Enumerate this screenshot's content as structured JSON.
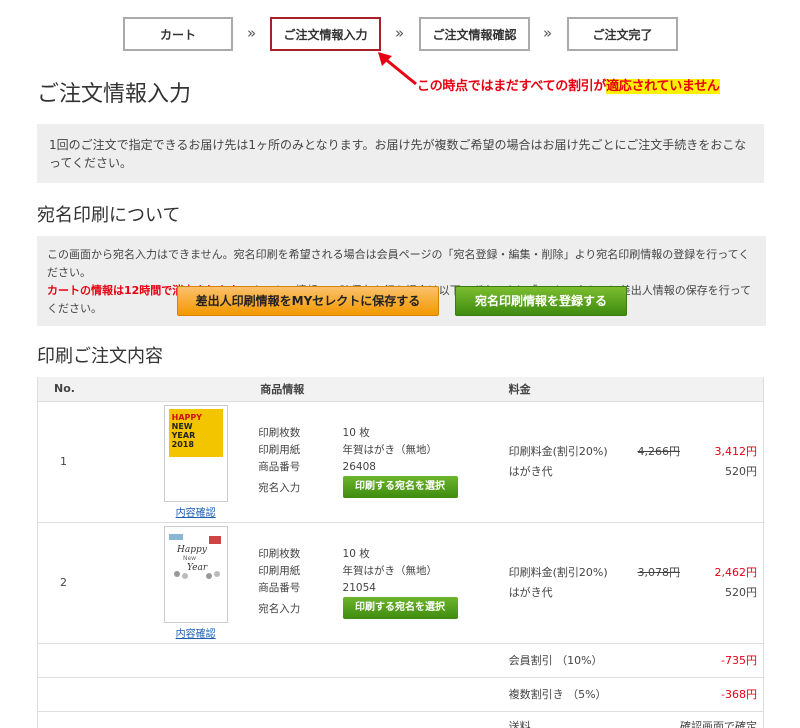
{
  "steps": [
    "カート",
    "ご注文情報入力",
    "ご注文情報確認",
    "ご注文完了"
  ],
  "step_separator": "»",
  "annotation": {
    "text_main": "この時点ではまだすべての割引が",
    "text_highlight": "適応されていません",
    "color": "#e60012"
  },
  "page_title": "ご注文情報入力",
  "notice": "1回のご注文で指定できるお届け先は1ヶ所のみとなります。お届け先が複数ご希望の場合はお届け先ごとにご注文手続きをおこなってください。",
  "atena": {
    "heading": "宛名印刷について",
    "line1": "この画面から宛名入力はできません。宛名印刷を希望される場合は会員ページの「宛名登録・編集・削除」より宛名印刷情報の登録を行ってください。",
    "line2_red": "カートの情報は12時間で消去されます。",
    "line2_rest": "カートの情報の一時保存を行う場合は以下のボタンより「MYセレクト」に差出人情報の保存を行ってください。",
    "save_button": "差出人印刷情報をMYセレクトに保存する",
    "register_button": "宛名印刷情報を登録する"
  },
  "order": {
    "heading": "印刷ご注文内容",
    "columns": [
      "No.",
      "商品情報",
      "料金"
    ],
    "items": [
      {
        "no": "1",
        "thumb_text": [
          "HAPPY",
          "NEW",
          "YEAR",
          "2018"
        ],
        "link": "内容確認",
        "specs": [
          {
            "label": "印刷枚数",
            "value": "10 枚"
          },
          {
            "label": "印刷用紙",
            "value": "年賀はがき（無地）"
          },
          {
            "label": "商品番号",
            "value": "26408"
          }
        ],
        "atena_label": "宛名入力",
        "select_button": "印刷する宛名を選択",
        "price_label": "印刷料金(割引20%)",
        "price_old": "4,266円",
        "price_new": "3,412円",
        "card_label": "はがき代",
        "card_price": "520円"
      },
      {
        "no": "2",
        "thumb_text": [
          "Happy",
          "New",
          "Year"
        ],
        "link": "内容確認",
        "specs": [
          {
            "label": "印刷枚数",
            "value": "10 枚"
          },
          {
            "label": "印刷用紙",
            "value": "年賀はがき（無地）"
          },
          {
            "label": "商品番号",
            "value": "21054"
          }
        ],
        "atena_label": "宛名入力",
        "select_button": "印刷する宛名を選択",
        "price_label": "印刷料金(割引20%)",
        "price_old": "3,078円",
        "price_new": "2,462円",
        "card_label": "はがき代",
        "card_price": "520円"
      }
    ],
    "discounts": [
      {
        "label": "会員割引 （10%）",
        "value": "-735円"
      },
      {
        "label": "複数割引き （5%）",
        "value": "-368円"
      }
    ],
    "partial_row": {
      "label": "送料",
      "value": "確認画面で確定"
    }
  }
}
